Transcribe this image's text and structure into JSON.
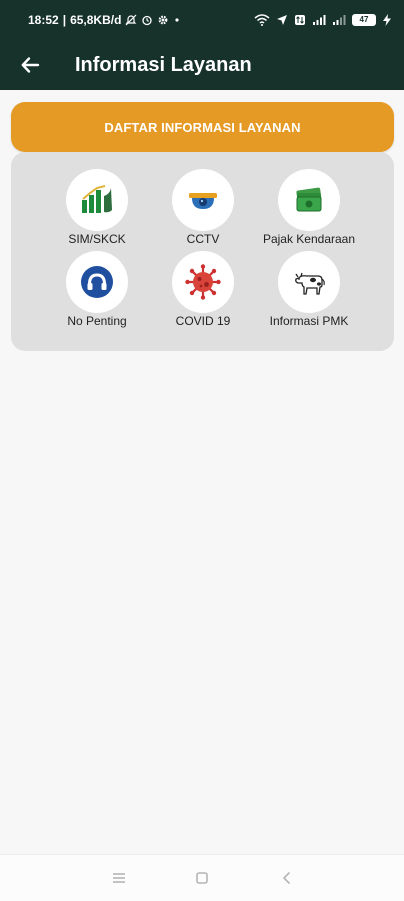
{
  "status_bar": {
    "time": "18:52",
    "network_speed": "65,8KB/d",
    "battery_level": "47",
    "icons": [
      "bell-off-icon",
      "alarm-icon",
      "gear-icon",
      "dot-icon",
      "wifi-icon",
      "location-icon",
      "data-icon",
      "signal-icon",
      "signal-icon",
      "battery-icon",
      "charging-icon"
    ]
  },
  "header": {
    "back_icon": "arrow-left-icon",
    "title": "Informasi Layanan"
  },
  "banner": {
    "label": "DAFTAR INFORMASI LAYANAN"
  },
  "services": [
    {
      "label": "SIM/SKCK",
      "icon": "license-card-icon"
    },
    {
      "label": "CCTV",
      "icon": "cctv-camera-icon"
    },
    {
      "label": "Pajak Kendaraan",
      "icon": "money-icon"
    },
    {
      "label": "No Penting",
      "icon": "phone-icon"
    },
    {
      "label": "COVID 19",
      "icon": "virus-icon"
    },
    {
      "label": "Informasi PMK",
      "icon": "cow-icon"
    }
  ],
  "nav_bar": {
    "icons": [
      "menu-icon",
      "home-square-icon",
      "back-chevron-icon"
    ]
  },
  "colors": {
    "app_bar": "#17312b",
    "banner": "#e59a25",
    "panel": "#dfdfdf",
    "background": "#f7f7f7"
  }
}
